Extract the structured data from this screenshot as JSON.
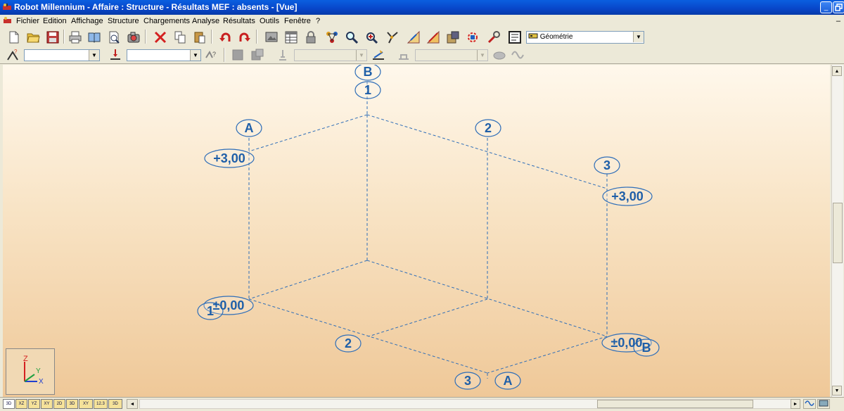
{
  "window": {
    "title": "Robot Millennium - Affaire : Structure - Résultats MEF : absents - [Vue]",
    "minimize_symbol": "_"
  },
  "menu": {
    "items": [
      "Fichier",
      "Edition",
      "Affichage",
      "Structure",
      "Chargements",
      "Analyse",
      "Résultats",
      "Outils",
      "Fenêtre",
      "?"
    ],
    "mdi_minimize_symbol": "–"
  },
  "toolbar": {
    "layout_combo_value": "Géométrie",
    "icons": [
      "new-file",
      "open-folder",
      "save",
      "print",
      "print-preview",
      "zoom-preview",
      "camera",
      "delete",
      "copy",
      "paste",
      "undo",
      "redo",
      "display",
      "tables",
      "lock",
      "nodes",
      "zoom",
      "zoom-window",
      "select",
      "properties",
      "section",
      "materials",
      "structure-view",
      "tools",
      "report"
    ]
  },
  "selection_bar": {
    "node_combo_value": "",
    "case_combo_value": "",
    "bar_combo_value": "",
    "panel_combo_value": ""
  },
  "view": {
    "background_top": "#fff8ec",
    "background_bottom": "#efc898",
    "line_color": "#2f6eb8",
    "label_color": "#1f5fa8",
    "axes": {
      "z": "Z",
      "y": "Y",
      "x": "X"
    },
    "grid_labels": [
      {
        "id": "b-top",
        "text": "B"
      },
      {
        "id": "one-top",
        "text": "1"
      },
      {
        "id": "a-left",
        "text": "A"
      },
      {
        "id": "two-right",
        "text": "2"
      },
      {
        "id": "three-right",
        "text": "3"
      },
      {
        "id": "level-top-left",
        "text": "+3,00"
      },
      {
        "id": "level-top-right",
        "text": "+3,00"
      },
      {
        "id": "level-bottom-left",
        "text": "±0,00"
      },
      {
        "id": "one-bottom-left",
        "text": "1"
      },
      {
        "id": "level-bottom-right",
        "text": "±0,00"
      },
      {
        "id": "b-bottom-right",
        "text": "B"
      },
      {
        "id": "two-bottom",
        "text": "2"
      },
      {
        "id": "three-bottom",
        "text": "3"
      },
      {
        "id": "a-bottom",
        "text": "A"
      }
    ]
  },
  "status": {
    "view_tabs": [
      "3D",
      "XZ",
      "YZ",
      "XY",
      "2D",
      "3D",
      "XY",
      "12.3",
      "3D"
    ]
  }
}
